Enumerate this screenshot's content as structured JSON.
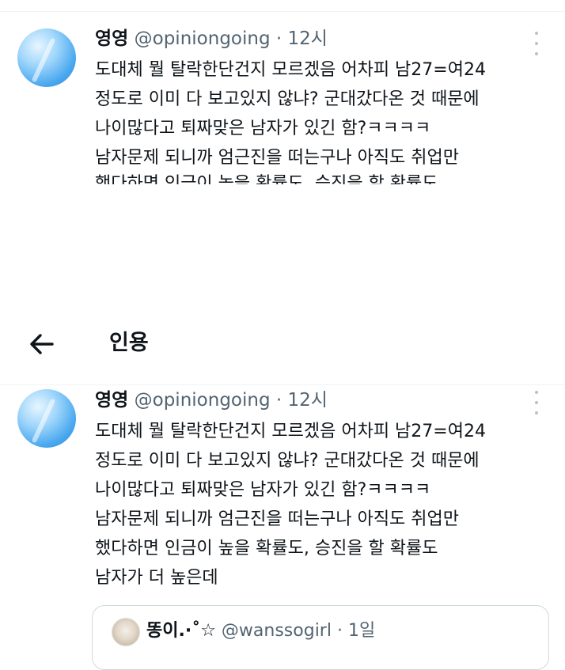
{
  "tweet": {
    "name": "영영",
    "handle": "@opiniongoing",
    "separator": "·",
    "time": "12시",
    "lines": [
      "도대체 뭘 탈락한단건지 모르겠음 어차피 남27=여24",
      "정도로 이미 다 보고있지 않냐? 군대갔다온 것 때문에",
      "나이많다고 퇴짜맞은 남자가 있긴 함?ㅋㅋㅋㅋ",
      "남자문제 되니까 엄근진을 떠는구나 아직도 취업만",
      "했다하면 인금이 높을 확률도, 승진을 할 확률도",
      "남자가 더 높은데"
    ]
  },
  "nav": {
    "title": "인용"
  },
  "quoted": {
    "name": "똥이.·˚☆",
    "handle": "@wanssogirl",
    "separator": "·",
    "time": "1일"
  },
  "colors": {
    "text": "#0f1419",
    "secondary": "#536471",
    "divider": "#eff3f4",
    "card_border": "#cfd9de",
    "avatar": "#4aa8ef"
  }
}
